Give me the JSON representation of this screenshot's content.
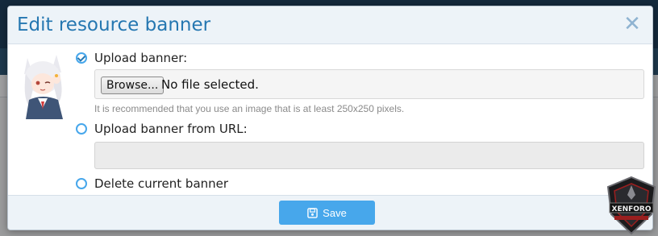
{
  "modal": {
    "title": "Edit resource banner",
    "close_icon": "close-icon"
  },
  "options": {
    "upload_label": "Upload banner:",
    "browse_label": "Browse...",
    "file_status": "No file selected.",
    "hint": "It is recommended that you use an image that is at least 250x250 pixels.",
    "url_label": "Upload banner from URL:",
    "url_value": "",
    "delete_label": "Delete current banner",
    "selected": "upload"
  },
  "footer": {
    "save_label": "Save",
    "save_icon": "save-icon"
  },
  "badge": {
    "text": "XENFORO",
    "icon": "xenforo-shield-logo"
  },
  "colors": {
    "accent": "#47a7eb",
    "title": "#2577b1",
    "header_bg": "#edf3f8"
  }
}
